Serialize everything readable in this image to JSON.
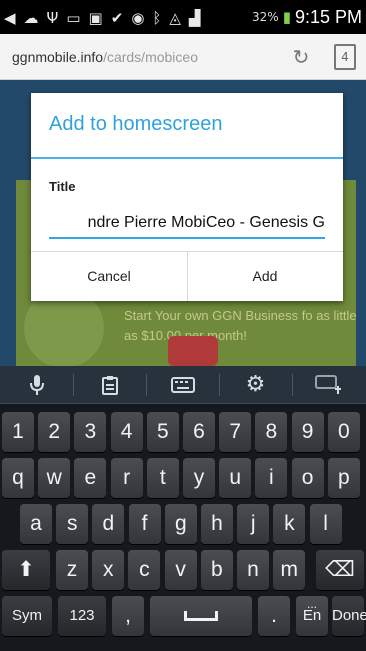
{
  "status_bar": {
    "icons": [
      "back-arrow-icon",
      "wifi-signal-icon",
      "usb-icon",
      "keyboard-icon",
      "flipboard-icon",
      "check-icon",
      "eye-icon",
      "bluetooth-icon",
      "wifi-icon",
      "signal-icon"
    ],
    "battery": "32%",
    "time": "9:15 PM"
  },
  "browser": {
    "url_domain": "ggnmobile.info",
    "url_path": "/cards/mobiceo",
    "reload_icon": "↻",
    "tabs_count": "4"
  },
  "page": {
    "promo_text": "Start Your own GGN Business fo as little as $10.00 per month!"
  },
  "dialog": {
    "title": "Add to homescreen",
    "field_label": "Title",
    "field_value": "ndre Pierre MobiCeo - Genesis G",
    "cancel_label": "Cancel",
    "add_label": "Add"
  },
  "keyboard": {
    "toolbar": [
      {
        "icon": "microphone-icon",
        "glyph": "🎤"
      },
      {
        "icon": "clipboard-icon",
        "glyph": "📋"
      },
      {
        "icon": "keyboard-icon",
        "glyph": "⌨"
      },
      {
        "icon": "settings-gear-icon",
        "glyph": "⚙"
      },
      {
        "icon": "keyboard-resize-icon",
        "glyph": "⌨"
      }
    ],
    "row_numbers": [
      "1",
      "2",
      "3",
      "4",
      "5",
      "6",
      "7",
      "8",
      "9",
      "0"
    ],
    "row_top": [
      "q",
      "w",
      "e",
      "r",
      "t",
      "y",
      "u",
      "i",
      "o",
      "p"
    ],
    "row_mid": [
      "a",
      "s",
      "d",
      "f",
      "g",
      "h",
      "j",
      "k",
      "l"
    ],
    "row_bot": [
      "z",
      "x",
      "c",
      "v",
      "b",
      "n",
      "m"
    ],
    "shift_glyph": "⬆",
    "backspace_glyph": "⌫",
    "sym_label": "Sym",
    "num_label": "123",
    "comma_label": ",",
    "period_label": ".",
    "lang_label": "En",
    "lang_dots": "...",
    "done_label": "Done"
  }
}
